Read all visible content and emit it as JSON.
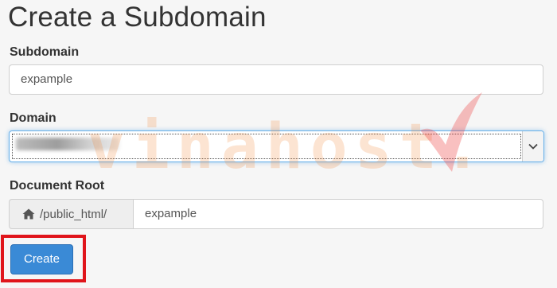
{
  "page": {
    "title": "Create a Subdomain"
  },
  "subdomain": {
    "label": "Subdomain",
    "value": "expample"
  },
  "domain": {
    "label": "Domain",
    "selected_value": ""
  },
  "document_root": {
    "label": "Document Root",
    "prefix": "/public_html/",
    "prefix_icon": "home-icon",
    "value": "expample"
  },
  "actions": {
    "create_label": "Create"
  },
  "watermark": {
    "text": "vinahost.",
    "color": "#f08232"
  },
  "colors": {
    "button": "#3a8ad6",
    "highlight": "#e0151b",
    "focus": "#66afe9"
  }
}
